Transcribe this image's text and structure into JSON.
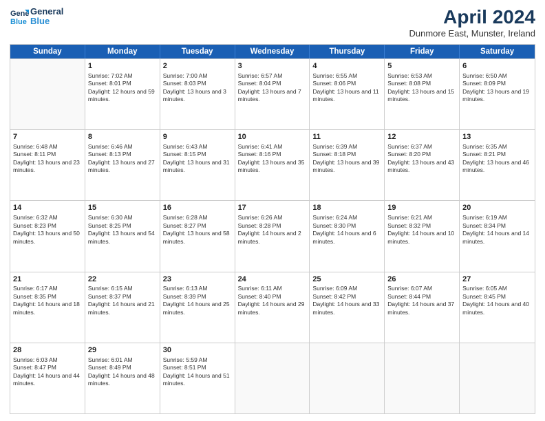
{
  "header": {
    "logo_line1": "General",
    "logo_line2": "Blue",
    "month_title": "April 2024",
    "location": "Dunmore East, Munster, Ireland"
  },
  "days_of_week": [
    "Sunday",
    "Monday",
    "Tuesday",
    "Wednesday",
    "Thursday",
    "Friday",
    "Saturday"
  ],
  "weeks": [
    [
      {
        "day": "",
        "empty": true
      },
      {
        "day": "1",
        "sunrise": "7:02 AM",
        "sunset": "8:01 PM",
        "daylight": "12 hours and 59 minutes."
      },
      {
        "day": "2",
        "sunrise": "7:00 AM",
        "sunset": "8:03 PM",
        "daylight": "13 hours and 3 minutes."
      },
      {
        "day": "3",
        "sunrise": "6:57 AM",
        "sunset": "8:04 PM",
        "daylight": "13 hours and 7 minutes."
      },
      {
        "day": "4",
        "sunrise": "6:55 AM",
        "sunset": "8:06 PM",
        "daylight": "13 hours and 11 minutes."
      },
      {
        "day": "5",
        "sunrise": "6:53 AM",
        "sunset": "8:08 PM",
        "daylight": "13 hours and 15 minutes."
      },
      {
        "day": "6",
        "sunrise": "6:50 AM",
        "sunset": "8:09 PM",
        "daylight": "13 hours and 19 minutes."
      }
    ],
    [
      {
        "day": "7",
        "sunrise": "6:48 AM",
        "sunset": "8:11 PM",
        "daylight": "13 hours and 23 minutes."
      },
      {
        "day": "8",
        "sunrise": "6:46 AM",
        "sunset": "8:13 PM",
        "daylight": "13 hours and 27 minutes."
      },
      {
        "day": "9",
        "sunrise": "6:43 AM",
        "sunset": "8:15 PM",
        "daylight": "13 hours and 31 minutes."
      },
      {
        "day": "10",
        "sunrise": "6:41 AM",
        "sunset": "8:16 PM",
        "daylight": "13 hours and 35 minutes."
      },
      {
        "day": "11",
        "sunrise": "6:39 AM",
        "sunset": "8:18 PM",
        "daylight": "13 hours and 39 minutes."
      },
      {
        "day": "12",
        "sunrise": "6:37 AM",
        "sunset": "8:20 PM",
        "daylight": "13 hours and 43 minutes."
      },
      {
        "day": "13",
        "sunrise": "6:35 AM",
        "sunset": "8:21 PM",
        "daylight": "13 hours and 46 minutes."
      }
    ],
    [
      {
        "day": "14",
        "sunrise": "6:32 AM",
        "sunset": "8:23 PM",
        "daylight": "13 hours and 50 minutes."
      },
      {
        "day": "15",
        "sunrise": "6:30 AM",
        "sunset": "8:25 PM",
        "daylight": "13 hours and 54 minutes."
      },
      {
        "day": "16",
        "sunrise": "6:28 AM",
        "sunset": "8:27 PM",
        "daylight": "13 hours and 58 minutes."
      },
      {
        "day": "17",
        "sunrise": "6:26 AM",
        "sunset": "8:28 PM",
        "daylight": "14 hours and 2 minutes."
      },
      {
        "day": "18",
        "sunrise": "6:24 AM",
        "sunset": "8:30 PM",
        "daylight": "14 hours and 6 minutes."
      },
      {
        "day": "19",
        "sunrise": "6:21 AM",
        "sunset": "8:32 PM",
        "daylight": "14 hours and 10 minutes."
      },
      {
        "day": "20",
        "sunrise": "6:19 AM",
        "sunset": "8:34 PM",
        "daylight": "14 hours and 14 minutes."
      }
    ],
    [
      {
        "day": "21",
        "sunrise": "6:17 AM",
        "sunset": "8:35 PM",
        "daylight": "14 hours and 18 minutes."
      },
      {
        "day": "22",
        "sunrise": "6:15 AM",
        "sunset": "8:37 PM",
        "daylight": "14 hours and 21 minutes."
      },
      {
        "day": "23",
        "sunrise": "6:13 AM",
        "sunset": "8:39 PM",
        "daylight": "14 hours and 25 minutes."
      },
      {
        "day": "24",
        "sunrise": "6:11 AM",
        "sunset": "8:40 PM",
        "daylight": "14 hours and 29 minutes."
      },
      {
        "day": "25",
        "sunrise": "6:09 AM",
        "sunset": "8:42 PM",
        "daylight": "14 hours and 33 minutes."
      },
      {
        "day": "26",
        "sunrise": "6:07 AM",
        "sunset": "8:44 PM",
        "daylight": "14 hours and 37 minutes."
      },
      {
        "day": "27",
        "sunrise": "6:05 AM",
        "sunset": "8:45 PM",
        "daylight": "14 hours and 40 minutes."
      }
    ],
    [
      {
        "day": "28",
        "sunrise": "6:03 AM",
        "sunset": "8:47 PM",
        "daylight": "14 hours and 44 minutes."
      },
      {
        "day": "29",
        "sunrise": "6:01 AM",
        "sunset": "8:49 PM",
        "daylight": "14 hours and 48 minutes."
      },
      {
        "day": "30",
        "sunrise": "5:59 AM",
        "sunset": "8:51 PM",
        "daylight": "14 hours and 51 minutes."
      },
      {
        "day": "",
        "empty": true
      },
      {
        "day": "",
        "empty": true
      },
      {
        "day": "",
        "empty": true
      },
      {
        "day": "",
        "empty": true
      }
    ]
  ]
}
